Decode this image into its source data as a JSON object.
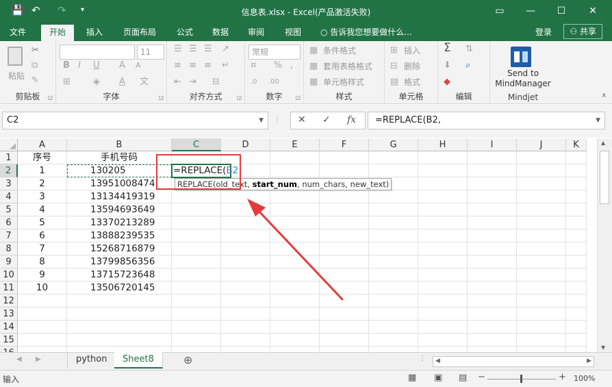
{
  "window": {
    "title": "信息表.xlsx - Excel(产品激活失败)",
    "controls": {
      "ribbon_display": "▭",
      "minimize": "—",
      "maximize": "☐",
      "close": "✕"
    }
  },
  "quick_access": {
    "save_icon": "💾",
    "undo_icon": "↶",
    "redo_icon": "↷",
    "customize_icon": "▾"
  },
  "tabs": {
    "file": "文件",
    "home": "开始",
    "insert": "插入",
    "layout": "页面布局",
    "formulas": "公式",
    "data": "数据",
    "review": "审阅",
    "view": "视图",
    "tell_me": "告诉我您想要做什么...",
    "login": "登录",
    "share": "共享"
  },
  "ribbon": {
    "clipboard": {
      "label": "剪贴板",
      "paste": "粘贴"
    },
    "font": {
      "label": "字体",
      "size": "11",
      "bold": "B",
      "italic": "I",
      "underline": "U",
      "font_color": "A",
      "grow": "A",
      "shrink": "A"
    },
    "alignment": {
      "label": "对齐方式"
    },
    "number": {
      "label": "数字",
      "format": "常规",
      "percent": "%"
    },
    "styles": {
      "label": "样式",
      "conditional": "条件格式",
      "as_table": "套用表格格式",
      "cell_styles": "单元格样式"
    },
    "cells": {
      "label": "单元格",
      "insert": "插入",
      "delete": "删除",
      "format": "格式"
    },
    "editing": {
      "label": "编辑",
      "sum": "Σ"
    },
    "mindjet": {
      "label": "Mindjet",
      "send_line1": "Send to",
      "send_line2": "MindManager"
    }
  },
  "formula_bar": {
    "name_box": "C2",
    "cancel": "✕",
    "enter": "✓",
    "fx": "fx",
    "formula": "=REPLACE(B2,"
  },
  "grid": {
    "columns": [
      "A",
      "B",
      "C",
      "D",
      "E",
      "F",
      "G",
      "H",
      "I",
      "J",
      "K"
    ],
    "rows": [
      "1",
      "2",
      "3",
      "4",
      "5",
      "6",
      "7",
      "8",
      "9",
      "10",
      "11",
      "12",
      "13",
      "14",
      "15",
      "16"
    ],
    "header_row": {
      "A": "序号",
      "B": "手机号码"
    },
    "data": [
      [
        "1",
        "130205"
      ],
      [
        "2",
        "13951008474"
      ],
      [
        "3",
        "13134419319"
      ],
      [
        "4",
        "13594693649"
      ],
      [
        "5",
        "13370213289"
      ],
      [
        "6",
        "13888239535"
      ],
      [
        "7",
        "15268716879"
      ],
      [
        "8",
        "13799856356"
      ],
      [
        "9",
        "13715723648"
      ],
      [
        "10",
        "13506720145"
      ]
    ],
    "editing_prefix": "=REPLACE(",
    "editing_ref": "B2",
    "tooltip": {
      "fn": "REPLACE(",
      "arg1": "old_text",
      "sep1": ", ",
      "arg2": "start_num",
      "sep2": ", ",
      "arg3": "num_chars",
      "sep3": ", ",
      "arg4": "new_text",
      "close": ")"
    }
  },
  "sheets": {
    "tabs": [
      "python",
      "Sheet8"
    ],
    "active": "Sheet8",
    "add": "⊕"
  },
  "status": {
    "mode": "输入",
    "zoom": "100%"
  },
  "colors": {
    "excel_green": "#217346",
    "annotation_red": "#e33b3b"
  }
}
